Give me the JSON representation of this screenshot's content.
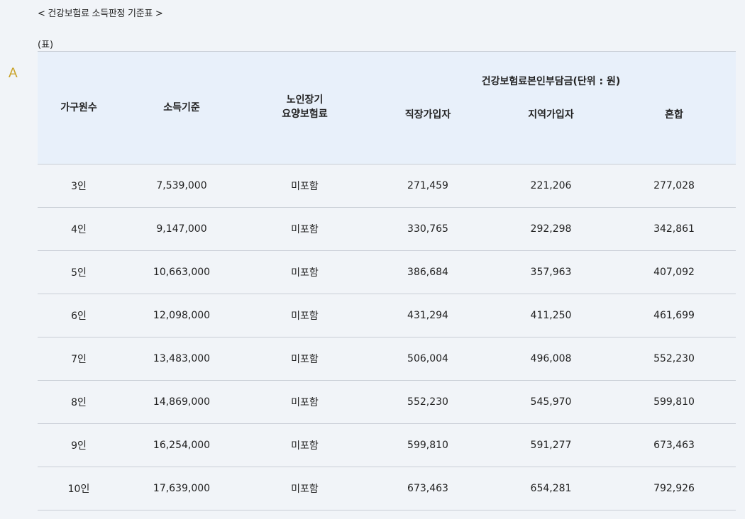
{
  "caption": "< 건강보험료 소득판정 기준표 >",
  "table_label": "(표)",
  "marker": "A",
  "table": {
    "headers": {
      "household": "가구원수",
      "income": "소득기준",
      "ltc_line1": "노인장기",
      "ltc_line2": "요양보험료",
      "group": "건강보험료본인부담금(단위 : 원)",
      "employee": "직장가입자",
      "regional": "지역가입자",
      "mixed": "혼합"
    },
    "rows": [
      {
        "household": "3인",
        "income": "7,539,000",
        "ltc": "미포함",
        "employee": "271,459",
        "regional": "221,206",
        "mixed": "277,028"
      },
      {
        "household": "4인",
        "income": "9,147,000",
        "ltc": "미포함",
        "employee": "330,765",
        "regional": "292,298",
        "mixed": "342,861"
      },
      {
        "household": "5인",
        "income": "10,663,000",
        "ltc": "미포함",
        "employee": "386,684",
        "regional": "357,963",
        "mixed": "407,092"
      },
      {
        "household": "6인",
        "income": "12,098,000",
        "ltc": "미포함",
        "employee": "431,294",
        "regional": "411,250",
        "mixed": "461,699"
      },
      {
        "household": "7인",
        "income": "13,483,000",
        "ltc": "미포함",
        "employee": "506,004",
        "regional": "496,008",
        "mixed": "552,230"
      },
      {
        "household": "8인",
        "income": "14,869,000",
        "ltc": "미포함",
        "employee": "552,230",
        "regional": "545,970",
        "mixed": "599,810"
      },
      {
        "household": "9인",
        "income": "16,254,000",
        "ltc": "미포함",
        "employee": "599,810",
        "regional": "591,277",
        "mixed": "673,463"
      },
      {
        "household": "10인",
        "income": "17,639,000",
        "ltc": "미포함",
        "employee": "673,463",
        "regional": "654,281",
        "mixed": "792,926"
      }
    ]
  }
}
